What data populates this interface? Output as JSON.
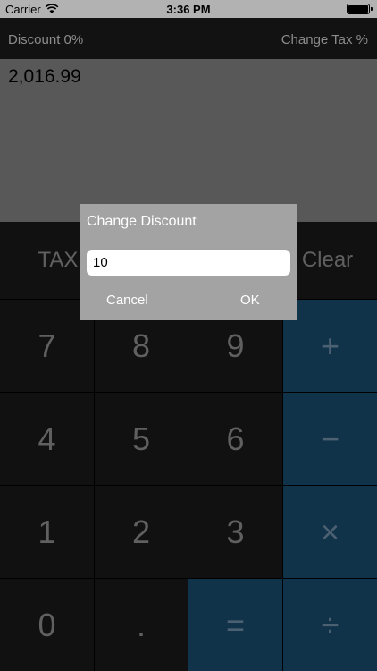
{
  "status_bar": {
    "carrier": "Carrier",
    "time": "3:36 PM"
  },
  "top_bar": {
    "discount_label": "Discount 0%",
    "change_tax_label": "Change Tax %"
  },
  "display": {
    "value": "2,016.99"
  },
  "keypad": {
    "tax": "TAX",
    "clear": "Clear",
    "digits": [
      "7",
      "8",
      "9",
      "4",
      "5",
      "6",
      "1",
      "2",
      "3",
      "0",
      "."
    ],
    "ops": {
      "plus": "+",
      "minus": "−",
      "multiply": "×",
      "equals": "=",
      "divide": "÷"
    }
  },
  "dialog": {
    "title": "Change Discount",
    "input_value": "10",
    "cancel_label": "Cancel",
    "ok_label": "OK"
  }
}
